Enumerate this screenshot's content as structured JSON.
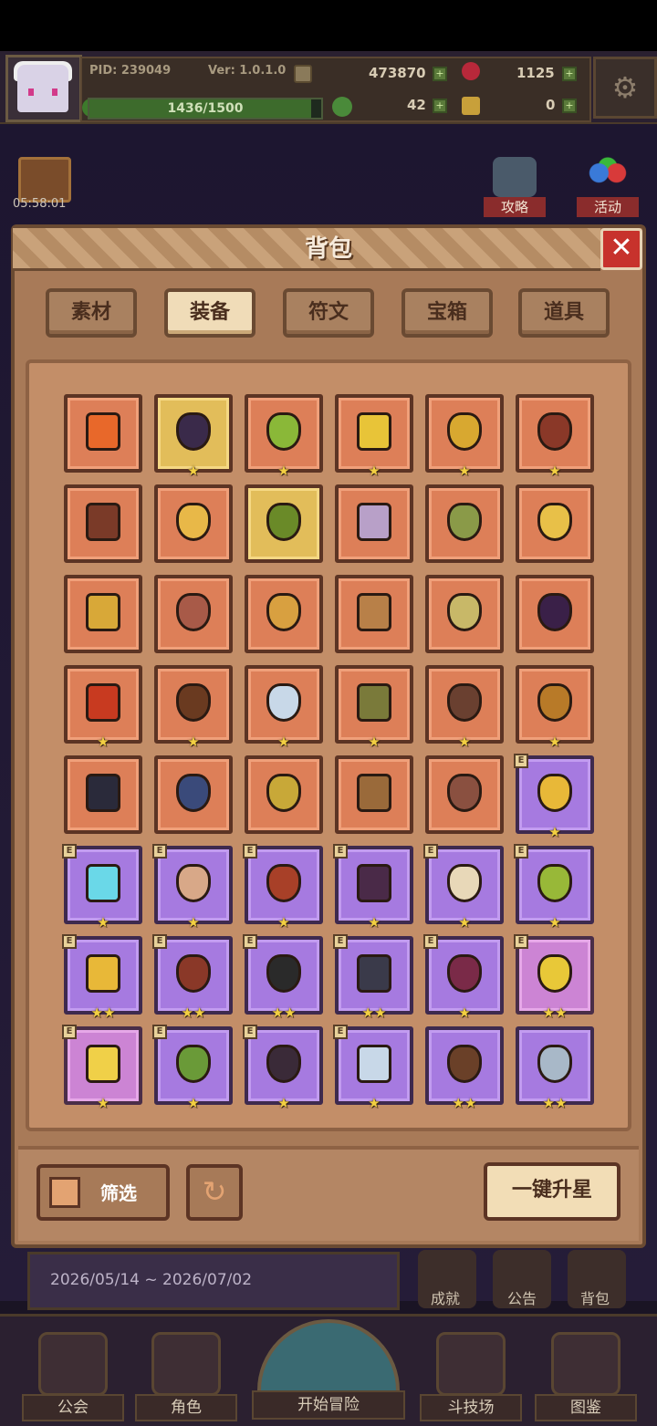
{
  "header": {
    "pid": "PID: 239049",
    "version": "Ver: 1.0.1.0",
    "gold": "473870",
    "gems": "1125",
    "exp_text": "1436/1500",
    "exp_fraction": 0.957,
    "clover": "42",
    "keys": "0"
  },
  "event": {
    "timer": "05:58:01"
  },
  "side_buttons": {
    "guide": "攻略",
    "activity": "活动"
  },
  "panel": {
    "title": "背包",
    "tabs": [
      "素材",
      "装备",
      "符文",
      "宝箱",
      "道具"
    ],
    "active_tab": "装备",
    "filter": "筛选",
    "star_up": "一键升星"
  },
  "items": [
    {
      "bg": "orange",
      "color": "#e8682a",
      "badge": "",
      "stars": ""
    },
    {
      "bg": "gold",
      "color": "#3a2a4a",
      "badge": "",
      "stars": "★"
    },
    {
      "bg": "orange",
      "color": "#8ab838",
      "badge": "",
      "stars": "★"
    },
    {
      "bg": "orange",
      "color": "#e8c438",
      "badge": "",
      "stars": "★"
    },
    {
      "bg": "orange",
      "color": "#d8a830",
      "badge": "",
      "stars": "★"
    },
    {
      "bg": "orange",
      "color": "#8a3828",
      "badge": "",
      "stars": "★"
    },
    {
      "bg": "orange",
      "color": "#7a3a28",
      "badge": "",
      "stars": ""
    },
    {
      "bg": "orange",
      "color": "#e8b848",
      "badge": "",
      "stars": ""
    },
    {
      "bg": "gold",
      "color": "#6a8a28",
      "badge": "",
      "stars": ""
    },
    {
      "bg": "orange",
      "color": "#b8a0c8",
      "badge": "",
      "stars": ""
    },
    {
      "bg": "orange",
      "color": "#8a9a48",
      "badge": "",
      "stars": ""
    },
    {
      "bg": "orange",
      "color": "#e8c048",
      "badge": "",
      "stars": ""
    },
    {
      "bg": "orange",
      "color": "#d8a838",
      "badge": "",
      "stars": ""
    },
    {
      "bg": "orange",
      "color": "#a85a48",
      "badge": "",
      "stars": ""
    },
    {
      "bg": "orange",
      "color": "#d8a040",
      "badge": "",
      "stars": ""
    },
    {
      "bg": "orange",
      "color": "#b88048",
      "badge": "",
      "stars": ""
    },
    {
      "bg": "orange",
      "color": "#c8b868",
      "badge": "",
      "stars": ""
    },
    {
      "bg": "orange",
      "color": "#3a2048",
      "badge": "",
      "stars": ""
    },
    {
      "bg": "orange",
      "color": "#c83a20",
      "badge": "",
      "stars": "★"
    },
    {
      "bg": "orange",
      "color": "#6a3a20",
      "badge": "",
      "stars": "★"
    },
    {
      "bg": "orange",
      "color": "#c8d8e8",
      "badge": "",
      "stars": "★"
    },
    {
      "bg": "orange",
      "color": "#7a7a3a",
      "badge": "",
      "stars": "★"
    },
    {
      "bg": "orange",
      "color": "#6a4030",
      "badge": "",
      "stars": "★"
    },
    {
      "bg": "orange",
      "color": "#b87a28",
      "badge": "",
      "stars": "★"
    },
    {
      "bg": "orange",
      "color": "#2a2a3a",
      "badge": "",
      "stars": ""
    },
    {
      "bg": "orange",
      "color": "#3a4a7a",
      "badge": "",
      "stars": ""
    },
    {
      "bg": "orange",
      "color": "#c8a838",
      "badge": "",
      "stars": ""
    },
    {
      "bg": "orange",
      "color": "#9a6a3a",
      "badge": "",
      "stars": ""
    },
    {
      "bg": "orange",
      "color": "#8a5040",
      "badge": "",
      "stars": ""
    },
    {
      "bg": "purple",
      "color": "#e8b838",
      "badge": "E",
      "stars": "★"
    },
    {
      "bg": "purple",
      "color": "#6ad8e8",
      "badge": "E",
      "stars": "★"
    },
    {
      "bg": "purple",
      "color": "#d8a888",
      "badge": "E",
      "stars": "★"
    },
    {
      "bg": "purple",
      "color": "#a84028",
      "badge": "E",
      "stars": "★"
    },
    {
      "bg": "purple",
      "color": "#4a2a48",
      "badge": "E",
      "stars": "★"
    },
    {
      "bg": "purple",
      "color": "#e8d8b8",
      "badge": "E",
      "stars": "★"
    },
    {
      "bg": "purple",
      "color": "#98b838",
      "badge": "E",
      "stars": "★"
    },
    {
      "bg": "purple",
      "color": "#e8b838",
      "badge": "E",
      "stars": "★★"
    },
    {
      "bg": "purple",
      "color": "#8a3828",
      "badge": "E",
      "stars": "★★"
    },
    {
      "bg": "purple",
      "color": "#2a2a2a",
      "badge": "E",
      "stars": "★★"
    },
    {
      "bg": "purple",
      "color": "#3a3a4a",
      "badge": "E",
      "stars": "★★"
    },
    {
      "bg": "purple",
      "color": "#7a2a48",
      "badge": "E",
      "stars": "★"
    },
    {
      "bg": "pink",
      "color": "#e8c838",
      "badge": "E",
      "stars": "★★"
    },
    {
      "bg": "pink",
      "color": "#f0d048",
      "badge": "E",
      "stars": "★"
    },
    {
      "bg": "purple",
      "color": "#6a9a38",
      "badge": "E",
      "stars": "★"
    },
    {
      "bg": "purple",
      "color": "#3a2a38",
      "badge": "E",
      "stars": "★"
    },
    {
      "bg": "purple",
      "color": "#c8d8e8",
      "badge": "E",
      "stars": "★"
    },
    {
      "bg": "purple",
      "color": "#6a4028",
      "badge": "",
      "stars": "★★"
    },
    {
      "bg": "purple",
      "color": "#a8b8c8",
      "badge": "",
      "stars": "★★"
    }
  ],
  "bottom": {
    "date_range": "2026/05/14 ~ 2026/07/02",
    "achievements": "成就",
    "notice": "公告",
    "backpack": "背包"
  },
  "nav": {
    "guild": "公会",
    "character": "角色",
    "start": "开始冒险",
    "arena": "斗技场",
    "codex": "图鉴"
  }
}
